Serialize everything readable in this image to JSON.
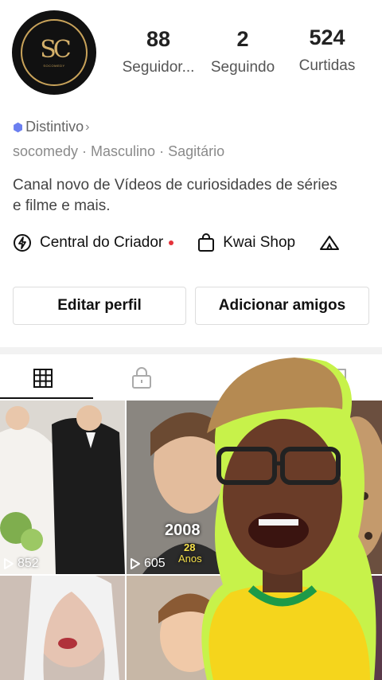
{
  "profile": {
    "avatar_monogram": "SC",
    "avatar_caption": "SOCOMEDY",
    "stats": [
      {
        "value": "88",
        "label": "Seguidor..."
      },
      {
        "value": "2",
        "label": "Seguindo"
      },
      {
        "value": "524",
        "label": "Curtidas"
      }
    ],
    "badge_label": "Distintivo",
    "badge_chevron": "›",
    "meta_line": "socomedy · Masculino · Sagitário",
    "bio": "Canal novo de Vídeos de curiosidades de séries e filme e mais."
  },
  "links": {
    "creator_center": "Central do Criador",
    "kwai_shop": "Kwai Shop"
  },
  "buttons": {
    "edit_profile": "Editar perfil",
    "add_friends": "Adicionar amigos"
  },
  "tabs": [
    {
      "name": "grid-icon",
      "active": true
    },
    {
      "name": "lock-icon",
      "active": false
    },
    {
      "name": "bookmark-icon",
      "active": false
    }
  ],
  "videos": [
    {
      "views": "852"
    },
    {
      "views": "605",
      "caption_year": "2008",
      "caption_age": "28",
      "caption_unit": "Anos"
    }
  ],
  "colors": {
    "accent_badge": "#6b7ff0",
    "notification_dot": "#e5333b",
    "avatar_gold": "#c9a35a",
    "jersey_yellow": "#f5d51c",
    "jersey_green": "#1d9a48"
  }
}
